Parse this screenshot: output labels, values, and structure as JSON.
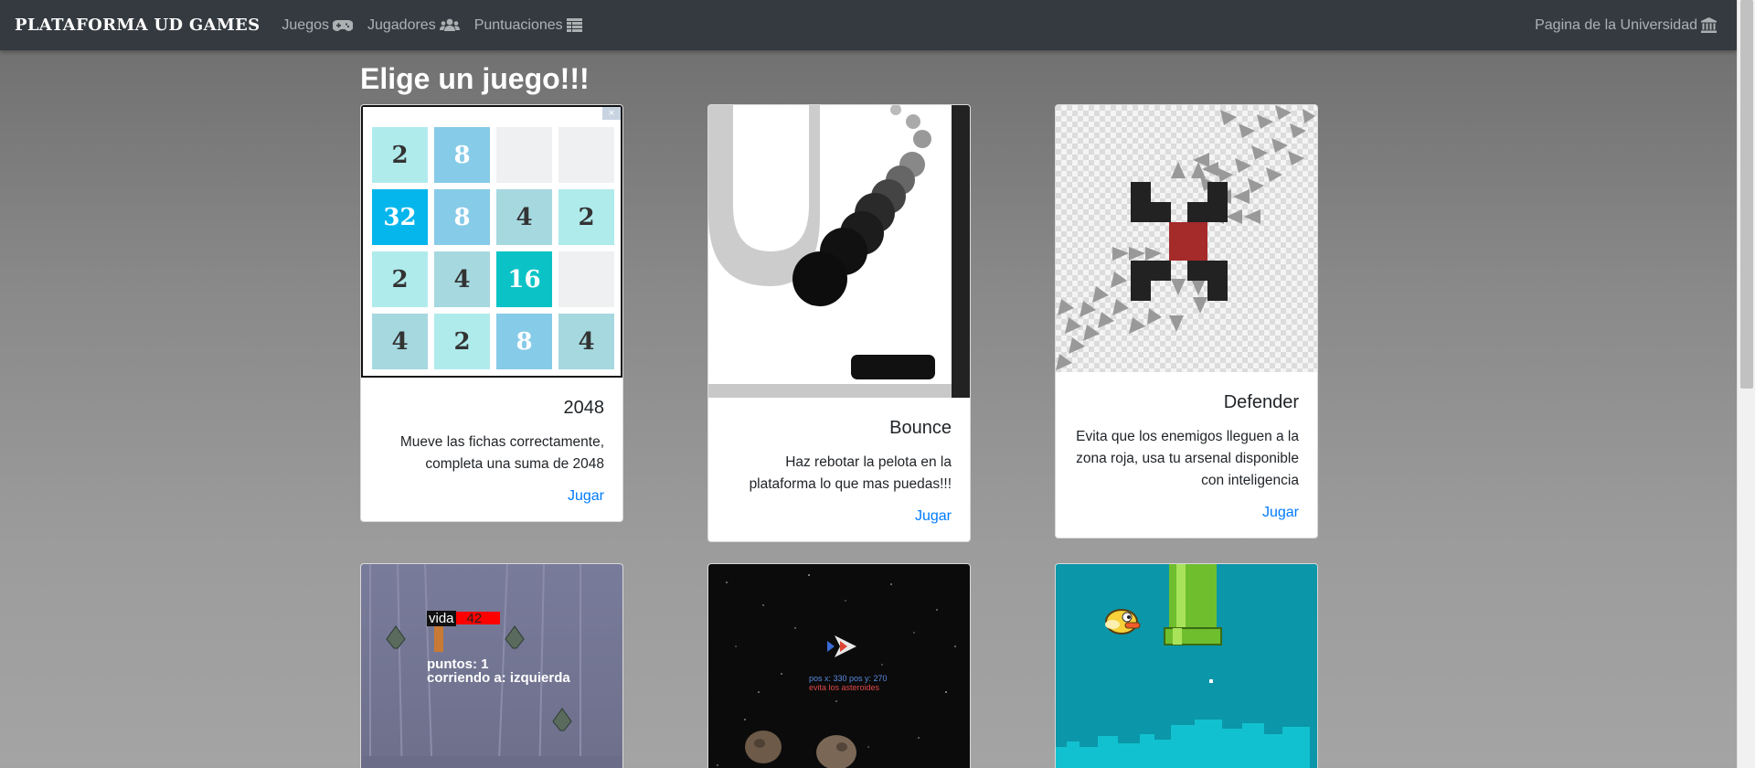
{
  "navbar": {
    "brand": "PLATAFORMA UD GAMES",
    "links": [
      {
        "label": "Juegos",
        "icon": "gamepad-icon"
      },
      {
        "label": "Jugadores",
        "icon": "users-icon"
      },
      {
        "label": "Puntuaciones",
        "icon": "table-icon"
      }
    ],
    "right_link": {
      "label": "Pagina de la Universidad",
      "icon": "university-icon"
    }
  },
  "page_title": "Elige un juego!!!",
  "games": [
    {
      "title": "2048",
      "description": "Mueve las fichas correctamente, completa una suma de 2048",
      "action": "Jugar"
    },
    {
      "title": "Bounce",
      "description": "Haz rebotar la pelota en la plataforma lo que mas puedas!!!",
      "action": "Jugar"
    },
    {
      "title": "Defender",
      "description": "Evita que los enemigos lleguen a la zona roja, usa tu arsenal disponible con inteligencia",
      "action": "Jugar"
    }
  ],
  "preview_2048": {
    "tiles": [
      [
        "2",
        "8",
        "",
        ""
      ],
      [
        "32",
        "8",
        "4",
        "2"
      ],
      [
        "2",
        "4",
        "16",
        ""
      ],
      [
        "4",
        "2",
        "8",
        "4"
      ]
    ]
  },
  "preview_shooter": {
    "life_label": "vida",
    "life_value": "42",
    "points_text": "puntos: 1",
    "direction_text": "corriendo a: izquierda"
  },
  "preview_asteroids": {
    "position_text": "pos x: 330 pos y: 270",
    "warning_text": "evita los asteroides"
  },
  "colors": {
    "navbar_bg": "#343a40",
    "link_blue": "#007bff",
    "defender_red": "#a52a2a",
    "flappy_bg": "#0b96a9"
  }
}
